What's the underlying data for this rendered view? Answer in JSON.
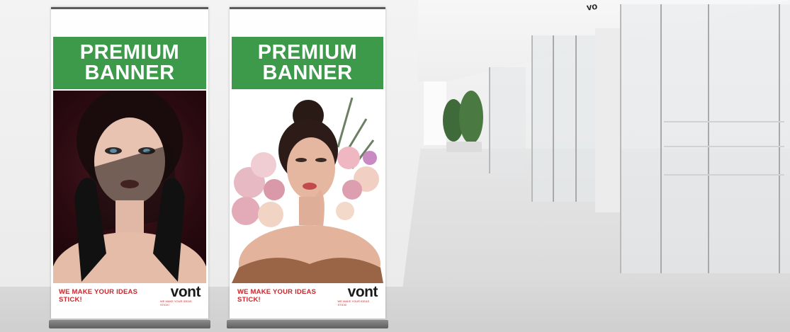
{
  "banners": [
    {
      "headline": "PREMIUM\nBANNER",
      "tagline": "WE MAKE YOUR IDEAS STICK!",
      "logo": "vont",
      "logo_subtext": "WE MAKE YOUR IDEAS STICK!"
    },
    {
      "headline": "PREMIUM\nBANNER",
      "tagline": "WE MAKE YOUR IDEAS STICK!",
      "logo": "vont",
      "logo_subtext": "WE MAKE YOUR IDEAS STICK!"
    }
  ],
  "colors": {
    "headline_green": "#3c9a4a",
    "tagline_red": "#c8282c",
    "logo_dark": "#1b1b1b"
  },
  "corner_sign": "vo"
}
